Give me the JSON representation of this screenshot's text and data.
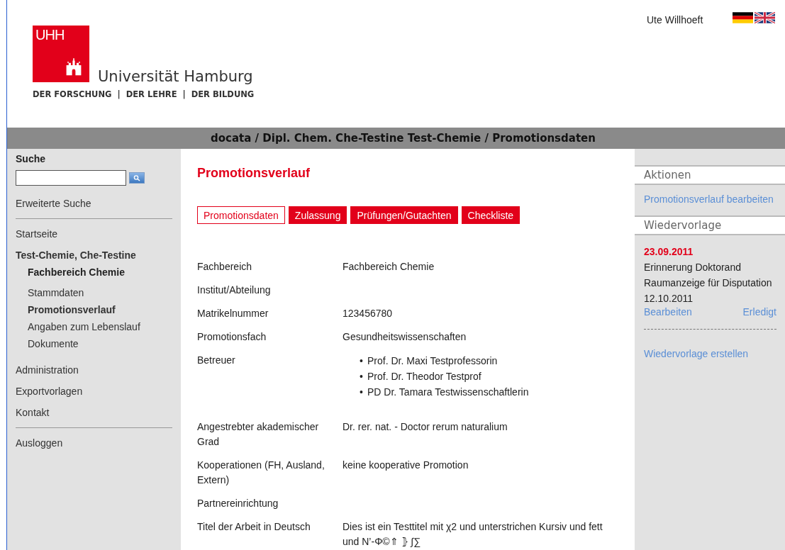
{
  "header": {
    "logo_mark": "UHH",
    "university": "Universität Hamburg",
    "tagline": "DER FORSCHUNG  |  DER LEHRE  |  DER BILDUNG",
    "user": "Ute Willhoeft",
    "languages": [
      {
        "kind": "de",
        "selected": true
      },
      {
        "kind": "en",
        "selected": false
      }
    ]
  },
  "breadcrumb": "docata / Dipl. Chem. Che-Testine Test-Chemie / Promotionsdaten",
  "sidebar": {
    "search_title": "Suche",
    "advanced_search": "Erweiterte Suche",
    "nav": [
      {
        "kind": "link",
        "label": "Startseite",
        "selected": false
      },
      {
        "kind": "person",
        "label": "Test-Chemie, Che-Testine",
        "subtitle": "Fachbereich Chemie",
        "selected": false,
        "children": [
          {
            "label": "Stammdaten",
            "selected": false
          },
          {
            "label": "Promotionsverlauf",
            "selected": true
          },
          {
            "label": "Angaben zum Lebenslauf",
            "selected": false
          },
          {
            "label": "Dokumente",
            "selected": false
          }
        ]
      },
      {
        "kind": "link",
        "label": "Administration",
        "selected": false
      },
      {
        "kind": "link",
        "label": "Exportvorlagen",
        "selected": false
      },
      {
        "kind": "link",
        "label": "Kontakt",
        "selected": false
      }
    ],
    "logout": "Ausloggen"
  },
  "main": {
    "title": "Promotionsverlauf",
    "tabs": [
      {
        "label": "Promotionsdaten",
        "selected": true
      },
      {
        "label": "Zulassung",
        "selected": false
      },
      {
        "label": "Prüfungen/Gutachten",
        "selected": false
      },
      {
        "label": "Checkliste",
        "selected": false
      }
    ],
    "fields": [
      {
        "kind": "text",
        "label": "Fachbereich",
        "value": "Fachbereich Chemie"
      },
      {
        "kind": "text",
        "label": "Institut/Abteilung"
      },
      {
        "kind": "text",
        "label": "Matrikelnummer",
        "value": "123456780"
      },
      {
        "kind": "text",
        "label": "Promotionsfach",
        "value": "Gesundheitswissenschaften"
      },
      {
        "kind": "list",
        "label": "Betreuer",
        "marker": "•",
        "values": [
          "Prof. Dr. Maxi Testprofessorin",
          "Prof. Dr. Theodor Testprof",
          "PD Dr. Tamara Testwissenschaftlerin"
        ]
      },
      {
        "kind": "text",
        "label": "Angestrebter akademischer Grad",
        "value": "Dr. rer. nat. - Doctor rerum naturalium"
      },
      {
        "kind": "text",
        "label": "Kooperationen (FH, Ausland, Extern)",
        "value": "keine kooperative Promotion"
      },
      {
        "kind": "text",
        "label": "Partnereinrichtung"
      },
      {
        "kind": "text",
        "label": "Titel der Arbeit in Deutsch",
        "value": "Dies ist ein Testtitel mit χ2 und unterstrichen Kursiv und fett und N’-Φ©⇑ ⦄ ∫∑"
      }
    ]
  },
  "right": {
    "actions_title": "Aktionen",
    "actions": [
      "Promotionsverlauf bearbeiten"
    ],
    "reminders_title": "Wiedervorlage",
    "reminders": [
      {
        "date": "23.09.2011",
        "lines": [
          "Erinnerung Doktorand",
          "Raumanzeige für Disputation",
          "12.10.2011"
        ],
        "edit": "Bearbeiten",
        "done": "Erledigt"
      }
    ],
    "create": "Wiedervorlage erstellen"
  }
}
